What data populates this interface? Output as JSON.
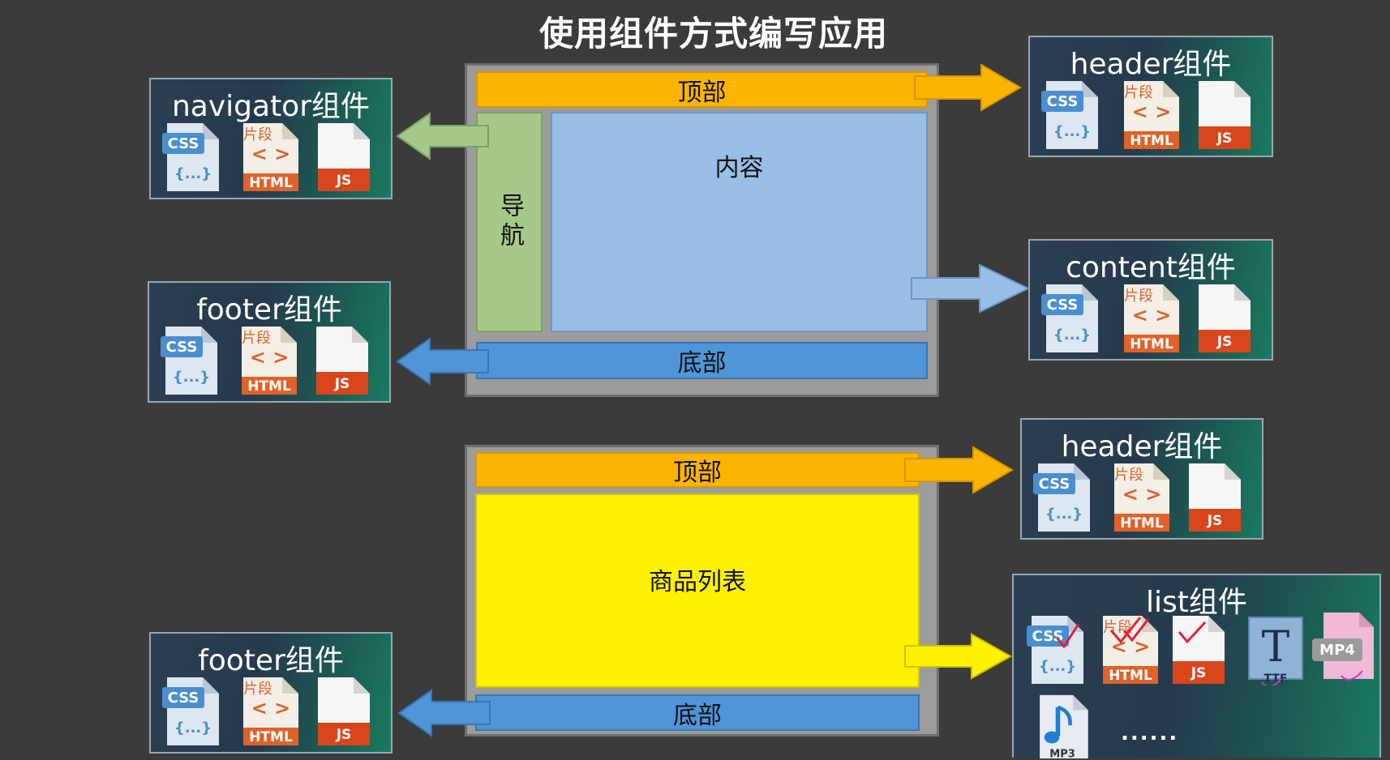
{
  "title": "使用组件方式编写应用",
  "diagram1": {
    "top": "顶部",
    "nav": "导航",
    "content": "内容",
    "bottom": "底部"
  },
  "diagram2": {
    "top": "顶部",
    "list": "商品列表",
    "bottom": "底部"
  },
  "components": {
    "navigator": "navigator组件",
    "header1": "header组件",
    "content": "content组件",
    "footer1": "footer组件",
    "header2": "header组件",
    "list": "list组件",
    "footer2": "footer组件"
  },
  "icon_labels": {
    "css": "CSS",
    "braces": "{...}",
    "snippet": "片段",
    "html": "HTML",
    "js": "JS",
    "ttf": "TTF",
    "ttf_letter": "T",
    "mp4": "MP4",
    "mp3": "MP3",
    "more": "......"
  },
  "colors": {
    "orange": "#fbb400",
    "green": "#a6c98a",
    "light_blue": "#99bfe6",
    "blue": "#4f95d8",
    "yellow": "#fff200",
    "frame_gray": "#9c9c9c"
  }
}
